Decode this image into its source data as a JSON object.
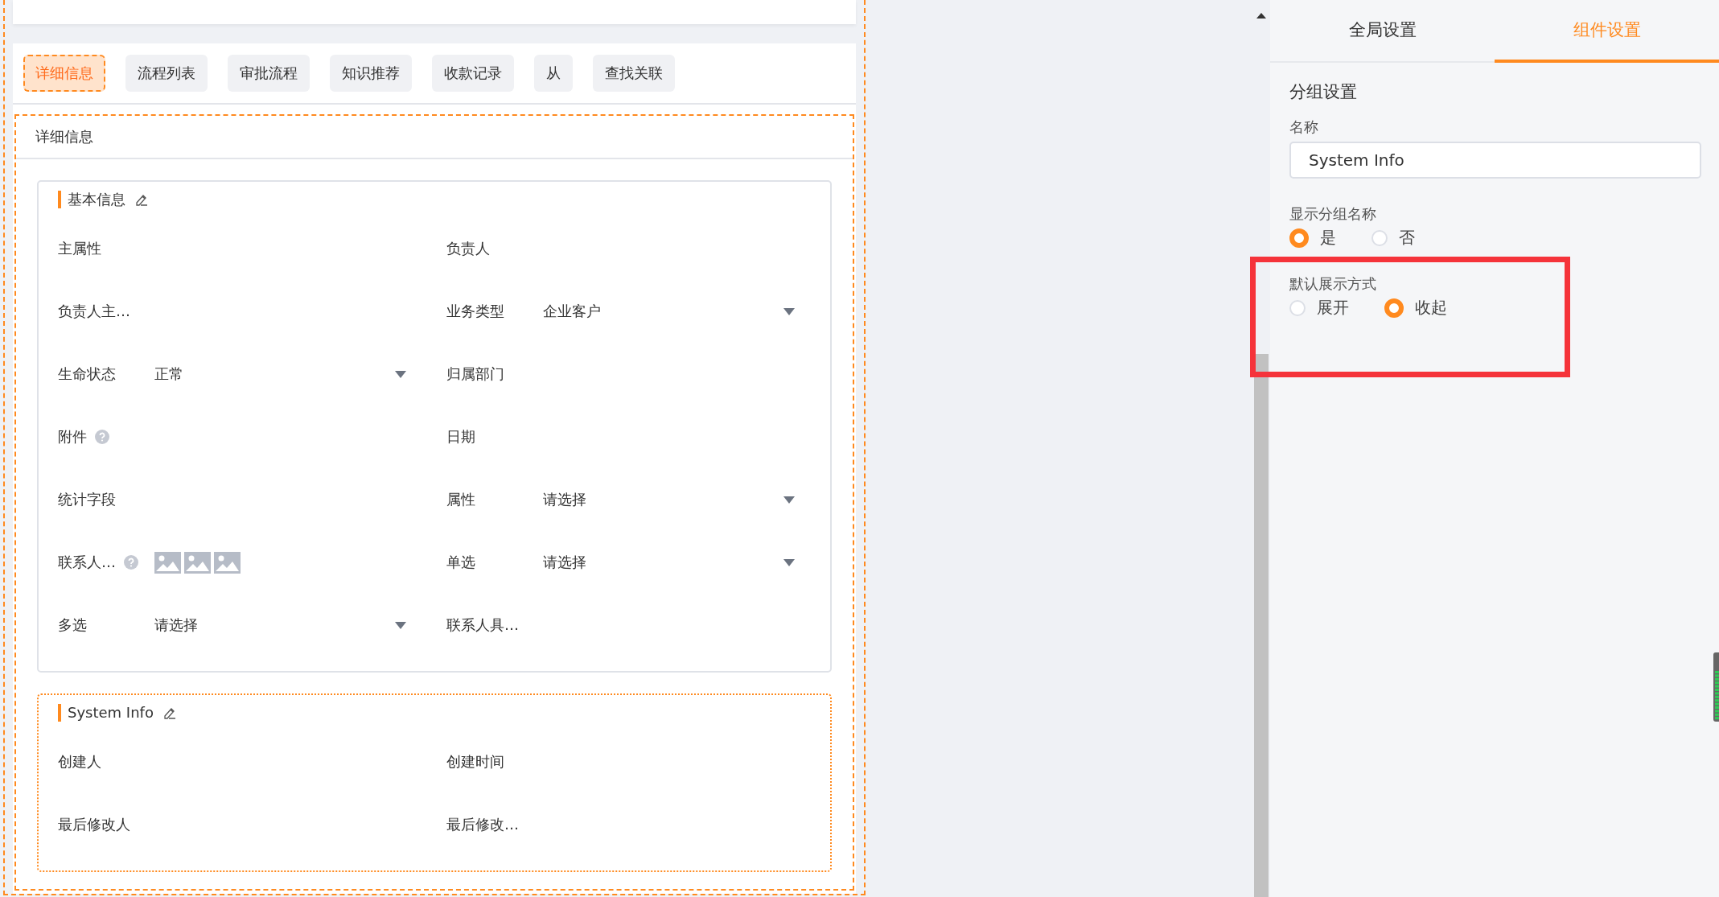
{
  "tabs": [
    {
      "label": "详细信息",
      "selected": true
    },
    {
      "label": "流程列表",
      "selected": false
    },
    {
      "label": "审批流程",
      "selected": false
    },
    {
      "label": "知识推荐",
      "selected": false
    },
    {
      "label": "收款记录",
      "selected": false
    },
    {
      "label": "从",
      "selected": false
    },
    {
      "label": "查找关联",
      "selected": false
    }
  ],
  "detail_panel": {
    "title": "详细信息",
    "groups": [
      {
        "title": "基本信息",
        "selected": false,
        "fields": [
          {
            "label": "主属性",
            "kind": "plain"
          },
          {
            "label": "负责人",
            "kind": "plain"
          },
          {
            "label": "负责人主…",
            "kind": "plain"
          },
          {
            "label": "业务类型",
            "kind": "select",
            "value": "企业客户"
          },
          {
            "label": "生命状态",
            "kind": "select",
            "value": "正常"
          },
          {
            "label": "归属部门",
            "kind": "plain"
          },
          {
            "label": "附件",
            "kind": "help"
          },
          {
            "label": "日期",
            "kind": "plain"
          },
          {
            "label": "统计字段",
            "kind": "plain"
          },
          {
            "label": "属性",
            "kind": "select",
            "placeholder": "请选择"
          },
          {
            "label": "联系人…",
            "kind": "images"
          },
          {
            "label": "单选",
            "kind": "select",
            "placeholder": "请选择"
          },
          {
            "label": "多选",
            "kind": "select",
            "placeholder": "请选择"
          },
          {
            "label": "联系人具…",
            "kind": "plain"
          }
        ]
      },
      {
        "title": "System Info",
        "selected": true,
        "fields": [
          {
            "label": "创建人",
            "kind": "plain"
          },
          {
            "label": "创建时间",
            "kind": "plain"
          },
          {
            "label": "最后修改人",
            "kind": "plain"
          },
          {
            "label": "最后修改…",
            "kind": "plain"
          }
        ]
      }
    ]
  },
  "settings": {
    "tabs": [
      {
        "label": "全局设置",
        "selected": false
      },
      {
        "label": "组件设置",
        "selected": true
      }
    ],
    "section_title": "分组设置",
    "name_field": {
      "label": "名称",
      "value": "System Info"
    },
    "radio_groups": [
      {
        "label": "显示分组名称",
        "highlighted": false,
        "options": [
          {
            "label": "是",
            "selected": true
          },
          {
            "label": "否",
            "selected": false
          }
        ]
      },
      {
        "label": "默认展示方式",
        "highlighted": true,
        "options": [
          {
            "label": "展开",
            "selected": false
          },
          {
            "label": "收起",
            "selected": true
          }
        ]
      }
    ]
  }
}
